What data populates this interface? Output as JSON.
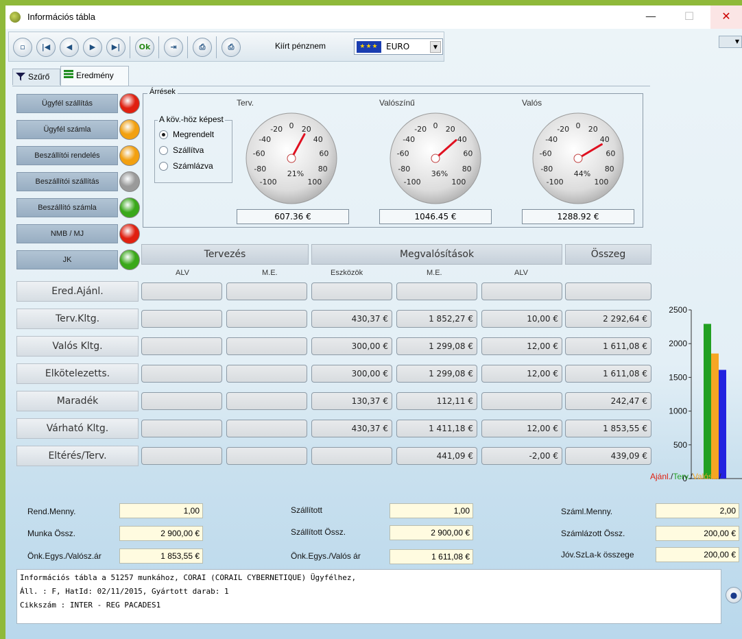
{
  "window": {
    "title": "Információs tábla",
    "min": "—",
    "max": "☐",
    "close": "✕"
  },
  "toolbar": {
    "buttons": [
      "new",
      "first",
      "prev",
      "next",
      "last",
      "ok",
      "exit",
      "print",
      "print-currency"
    ],
    "ok_label": "Ok",
    "print_currency_label": "Kiírt pénznem",
    "currency_value": "EURO"
  },
  "tabs": [
    {
      "label": "Szűrő"
    },
    {
      "label": "Eredmény"
    }
  ],
  "status": [
    {
      "label": "Ügyfél szállítás",
      "color": "#e02010"
    },
    {
      "label": "Ügyfél számla",
      "color": "#f2a010"
    },
    {
      "label": "Beszállítói rendelés",
      "color": "#f2a010"
    },
    {
      "label": "Beszállítói szállítás",
      "color": "#9a9a9a"
    },
    {
      "label": "Beszállító számla",
      "color": "#3aa81a"
    },
    {
      "label": "NMB / MJ",
      "color": "#e02010"
    },
    {
      "label": "JK",
      "color": "#3aa81a"
    }
  ],
  "margins": {
    "legend": "Árrések",
    "compare_legend": "A köv.-höz képest",
    "options": [
      {
        "label": "Megrendelt",
        "selected": true
      },
      {
        "label": "Szállítva",
        "selected": false
      },
      {
        "label": "Számlázva",
        "selected": false
      }
    ],
    "gauges": [
      {
        "title": "Terv.",
        "percent": 21,
        "percent_label": "21%",
        "value": "607.36 €"
      },
      {
        "title": "Valószínű",
        "percent": 36,
        "percent_label": "36%",
        "value": "1046.45 €"
      },
      {
        "title": "Valós",
        "percent": 44,
        "percent_label": "44%",
        "value": "1288.92 €"
      }
    ],
    "ticks": [
      "-100",
      "-80",
      "-60",
      "-40",
      "-20",
      "0",
      "20",
      "40",
      "60",
      "80",
      "100"
    ]
  },
  "grid": {
    "headers": {
      "planning": "Tervezés",
      "realizations": "Megvalósítások",
      "total": "Összeg"
    },
    "subheaders": [
      "ALV",
      "M.E.",
      "Eszközök",
      "M.E.",
      "ALV"
    ],
    "rows": [
      {
        "label": "Ered.Ajánl.",
        "cells": [
          "",
          "",
          "",
          "",
          "",
          ""
        ]
      },
      {
        "label": "Terv.Kltg.",
        "cells": [
          "",
          "",
          "430,37 €",
          "1 852,27 €",
          "10,00 €",
          "2 292,64 €"
        ]
      },
      {
        "label": "Valós Kltg.",
        "cells": [
          "",
          "",
          "300,00 €",
          "1 299,08 €",
          "12,00 €",
          "1 611,08 €"
        ]
      },
      {
        "label": "Elkötelezetts.",
        "cells": [
          "",
          "",
          "300,00 €",
          "1 299,08 €",
          "12,00 €",
          "1 611,08 €"
        ]
      },
      {
        "label": "Maradék",
        "cells": [
          "",
          "",
          "130,37 €",
          "112,11 €",
          "",
          "242,47 €"
        ]
      },
      {
        "label": "Várható Kltg.",
        "cells": [
          "",
          "",
          "430,37 €",
          "1 411,18 €",
          "12,00 €",
          "1 853,55 €"
        ]
      },
      {
        "label": "Eltérés/Terv.",
        "cells": [
          "",
          "",
          "",
          "441,09 €",
          "-2,00 €",
          "439,09 €"
        ]
      }
    ]
  },
  "chart_data": {
    "type": "bar",
    "categories": [
      "Ajánl.",
      "Terv.",
      "Valósz.",
      "Valós"
    ],
    "values": [
      0,
      2292.64,
      1853.55,
      1611.08
    ],
    "colors": [
      "#e02010",
      "#22a022",
      "#f5a623",
      "#2222e0"
    ],
    "yticks": [
      "0",
      "500",
      "1000",
      "1500",
      "2000",
      "2500"
    ],
    "ylim": [
      0,
      2500
    ],
    "legend_text": [
      {
        "text": "Ajánl.",
        "color": "#e02010"
      },
      {
        "text": "/",
        "color": "#222222"
      },
      {
        "text": "Terv.",
        "color": "#22a022"
      },
      {
        "text": "/",
        "color": "#222222"
      },
      {
        "text": "Valósz.",
        "color": "#f5a623"
      },
      {
        "text": "/",
        "color": "#222222"
      }
    ]
  },
  "footer": {
    "rend_menny_label": "Rend.Menny.",
    "rend_menny": "1,00",
    "munka_ossz_label": "Munka Össz.",
    "munka_ossz": "2 900,00 €",
    "onk_egys_valosz_label": "Önk.Egys./Valósz.ár",
    "onk_egys_valosz": "1 853,55 €",
    "szallitott_label": "Szállított",
    "szallitott": "1,00",
    "szallitott_ossz_label": "Szállított Össz.",
    "szallitott_ossz": "2 900,00 €",
    "onk_egys_valos_label": "Önk.Egys./Valós ár",
    "onk_egys_valos": "1 611,08 €",
    "szaml_menny_label": "Száml.Menny.",
    "szaml_menny": "2,00",
    "szamlazott_ossz_label": "Számlázott Össz.",
    "szamlazott_ossz": "200,00 €",
    "jov_szla_label": "Jóv.SzLa-k összege",
    "jov_szla": "200,00 €"
  },
  "info": {
    "line1": "Információs tábla a 51257 munkához, CORAI (CORAIL CYBERNETIQUE) Ügyfélhez,",
    "line2": "Áll. : F, HatId: 02/11/2015, Gyártott darab: 1",
    "line3": "Cikkszám : INTER - REG PACADES1"
  }
}
